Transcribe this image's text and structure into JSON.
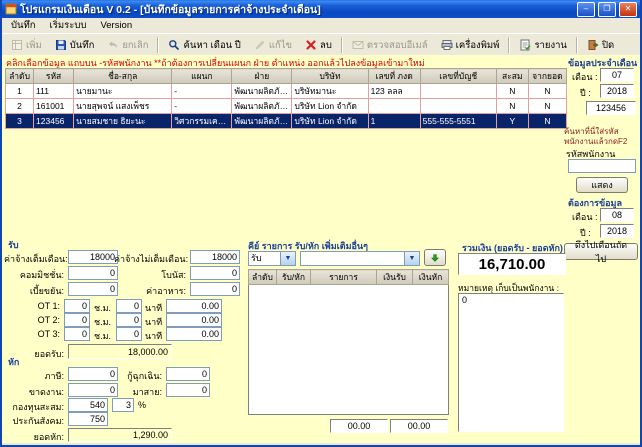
{
  "window": {
    "title": "โปรแกรมเงินเดือน V 0.2 - [บันทึกข้อมูลรายการค่าจ้างประจำเดือน]",
    "controls": {
      "minimize": "–",
      "maximize": "❐",
      "close": "✕"
    }
  },
  "menu": {
    "items": [
      "บันทึก",
      "เริ่มระบบ",
      "Version"
    ]
  },
  "toolbar": {
    "items": [
      {
        "label": "เพิ่ม",
        "icon": "add-icon",
        "enabled": false
      },
      {
        "label": "บันทึก",
        "icon": "save-icon",
        "enabled": true
      },
      {
        "label": "ยกเลิก",
        "icon": "undo-icon",
        "enabled": false
      },
      {
        "label": "ค้นหา เดือน ปี",
        "icon": "search-icon",
        "enabled": true
      },
      {
        "label": "แก้ไข",
        "icon": "edit-icon",
        "enabled": false
      },
      {
        "label": "ลบ",
        "icon": "delete-icon",
        "enabled": true
      },
      {
        "label": "ตรวจสอบอีเมล์",
        "icon": "email-icon",
        "enabled": false
      },
      {
        "label": "เครื่องพิมพ์",
        "icon": "printer-icon",
        "enabled": true
      },
      {
        "label": "รายงาน",
        "icon": "report-icon",
        "enabled": true
      },
      {
        "label": "ปิด",
        "icon": "close-icon",
        "enabled": true
      }
    ]
  },
  "hint": "คลิกเลือกข้อมูล แถบบน -รหัสพนักงาน **ถ้าต้องการเปลี่ยนแผนก ฝ่าย ตำแหน่ง ออกแล้วไปลงข้อมูลเข้ามาใหม่",
  "grid": {
    "columns": [
      "ลำดับ",
      "รหัส",
      "ชื่อ-สกุล",
      "แผนก",
      "ฝ่าย",
      "บริษัท",
      "เลขที่ ภงด",
      "เลขที่บัญชี",
      "สะสม",
      "จากยอด"
    ],
    "rows": [
      {
        "cells": [
          "1",
          "111",
          "นายมานะ",
          "-",
          "พัฒนาผลิตภัณฑ์",
          "บริษัทมานะ",
          "123 ลลล",
          "",
          "N",
          "N"
        ]
      },
      {
        "cells": [
          "2",
          "161001",
          "นายสุพจน์ แสงเพ็ชร",
          "-",
          "พัฒนาผลิตภัณฑ์",
          "บริษัท Lion จำกัด",
          "",
          "",
          "N",
          "N"
        ]
      },
      {
        "cells": [
          "3",
          "123456",
          "นายสมชาย ธิยะนะ",
          "วิศวกรรมเครื่องกล",
          "พัฒนาผลิตภัณฑ์",
          "บริษัท Lion จำกัด",
          "1",
          "555-555-5551",
          "Y",
          "N"
        ]
      }
    ]
  },
  "month_panel": {
    "title": "ข้อมูลประจำเดือน",
    "month_label": "เดือน :",
    "month_value": "07",
    "year_label": "ปี :",
    "year_value": "2018",
    "employee_code": "123456"
  },
  "search_panel": {
    "title": "ค้นหาที่นี่ใส่รหัสพนักงานแล้วกดF2",
    "field_label": "รหัสพนักงาน",
    "field_value": "",
    "show_button": "แสดง"
  },
  "target_panel": {
    "title": "ต้องการข้อมูล",
    "month_label": "เดือน :",
    "month_value": "08",
    "year_label": "ปี :",
    "year_value": "2018",
    "pull_button": "ดึงไปเดือนถัดไป"
  },
  "income": {
    "title": "รับ",
    "full_wage_label": "ค่าจ้างเต็มเดือน:",
    "full_wage_value": "18000",
    "partial_wage_label": "ค่าจ้างไม่เต็มเดือน:",
    "partial_wage_value": "18000",
    "commission_label": "คอมมิชชั่น:",
    "commission_value": "0",
    "bonus_label": "โบนัส:",
    "bonus_value": "0",
    "diligence_label": "เบี้ยขยัน:",
    "diligence_value": "0",
    "food_label": "ค่าอาหาร:",
    "food_value": "0",
    "hours_unit": "ช.ม.",
    "minutes_unit": "นาที",
    "ot1_label": "OT 1:",
    "ot1_hours": "0",
    "ot1_minutes": "0",
    "ot1_amount": "0.00",
    "ot2_label": "OT 2:",
    "ot2_hours": "0",
    "ot2_minutes": "0",
    "ot2_amount": "0.00",
    "ot3_label": "OT 3:",
    "ot3_hours": "0",
    "ot3_minutes": "0",
    "ot3_amount": "0.00",
    "total_label": "ยอดรับ:",
    "total_value": "18,000.00"
  },
  "deduction": {
    "title": "หัก",
    "tax_label": "ภาษี:",
    "tax_value": "0",
    "emergency_loan_label": "กู้ฉุกเฉิน:",
    "emergency_loan_value": "0",
    "absence_label": "ขาดงาน:",
    "absence_value": "0",
    "late_label": "มาสาย:",
    "late_value": "0",
    "fund_label": "กองทุนสะสม:",
    "fund_value": "540",
    "fund_percent": "3",
    "percent_unit": "%",
    "social_label": "ประกันสังคม:",
    "social_value": "750",
    "total_label": "ยอดหัก:",
    "total_value": "1,290.00"
  },
  "extra_items": {
    "title": "คีย์ รายการ รับ/หัก เพิ่มเติมอื่นๆ",
    "type_value": "รับ",
    "item_value": "",
    "columns": [
      "ลำดับ",
      "รับ/หัก",
      "รายการ",
      "เงินรับ",
      "เงินหัก"
    ],
    "total_receive": "00.00",
    "total_deduct": "00.00"
  },
  "summary": {
    "label": "รวมเงิน (ยอดรับ - ยอดหัก)",
    "total": "16,710.00",
    "note_label": "หมายเหตุ เก็บเป็นพนักงาน :",
    "note_items": [
      "0"
    ]
  }
}
